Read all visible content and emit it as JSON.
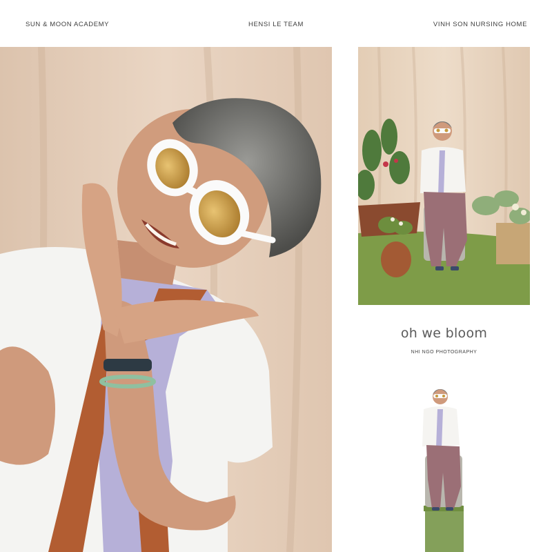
{
  "header": {
    "left": "SUN & MOON ACADEMY",
    "center": "HENSI LE TEAM",
    "right": "VINH SON NURSING HOME"
  },
  "brand": {
    "title": "oh we bloom",
    "credit": "NHI NGO PHOTOGRAPHY"
  },
  "colors": {
    "background": "#ffffff",
    "backdrop_beige": "#e6cfba",
    "lawn_green": "#7e9c48",
    "pedestal_green": "#84a05a",
    "scarf_purple": "#b6b0d8",
    "scarf_rust": "#b25d32",
    "sunglasses_white": "#fafafa",
    "lens_amber": "#c89a3c"
  },
  "photos": [
    {
      "id": "main",
      "subject": "smiling woman in white sunglasses with hands under chin"
    },
    {
      "id": "garden",
      "subject": "woman seated on stool in garden set with plants"
    },
    {
      "id": "cutout",
      "subject": "woman seated on green pedestal"
    }
  ]
}
